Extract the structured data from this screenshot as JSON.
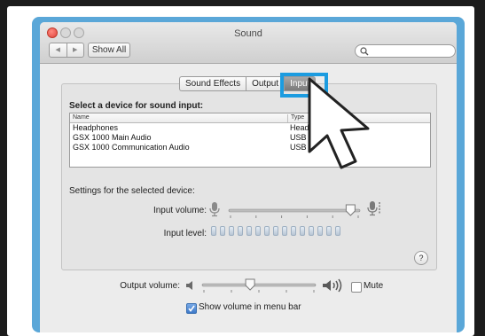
{
  "window": {
    "title": "Sound"
  },
  "toolbar": {
    "back": "◀",
    "forward": "▶",
    "show_all": "Show All",
    "search_placeholder": ""
  },
  "tabs": [
    {
      "label": "Sound Effects",
      "selected": false
    },
    {
      "label": "Output",
      "selected": false
    },
    {
      "label": "Input",
      "selected": true
    }
  ],
  "input": {
    "heading": "Select a device for sound input:",
    "columns": {
      "name": "Name",
      "type": "Type"
    },
    "devices": [
      {
        "name": "Headphones",
        "type": "Headph"
      },
      {
        "name": "GSX 1000 Main Audio",
        "type": "USB"
      },
      {
        "name": "GSX 1000 Communication Audio",
        "type": "USB"
      }
    ],
    "settings_label": "Settings for the selected device:",
    "volume_label": "Input volume:",
    "volume_value": 0.94,
    "level_label": "Input level:",
    "level_segments": 15,
    "help": "?"
  },
  "output": {
    "volume_label": "Output volume:",
    "volume_value": 0.42,
    "mute_label": "Mute",
    "mute_checked": false,
    "show_in_menu_label": "Show volume in menu bar",
    "show_in_menu_checked": true
  },
  "annotation": {
    "highlight_color": "#1c9ce0"
  }
}
